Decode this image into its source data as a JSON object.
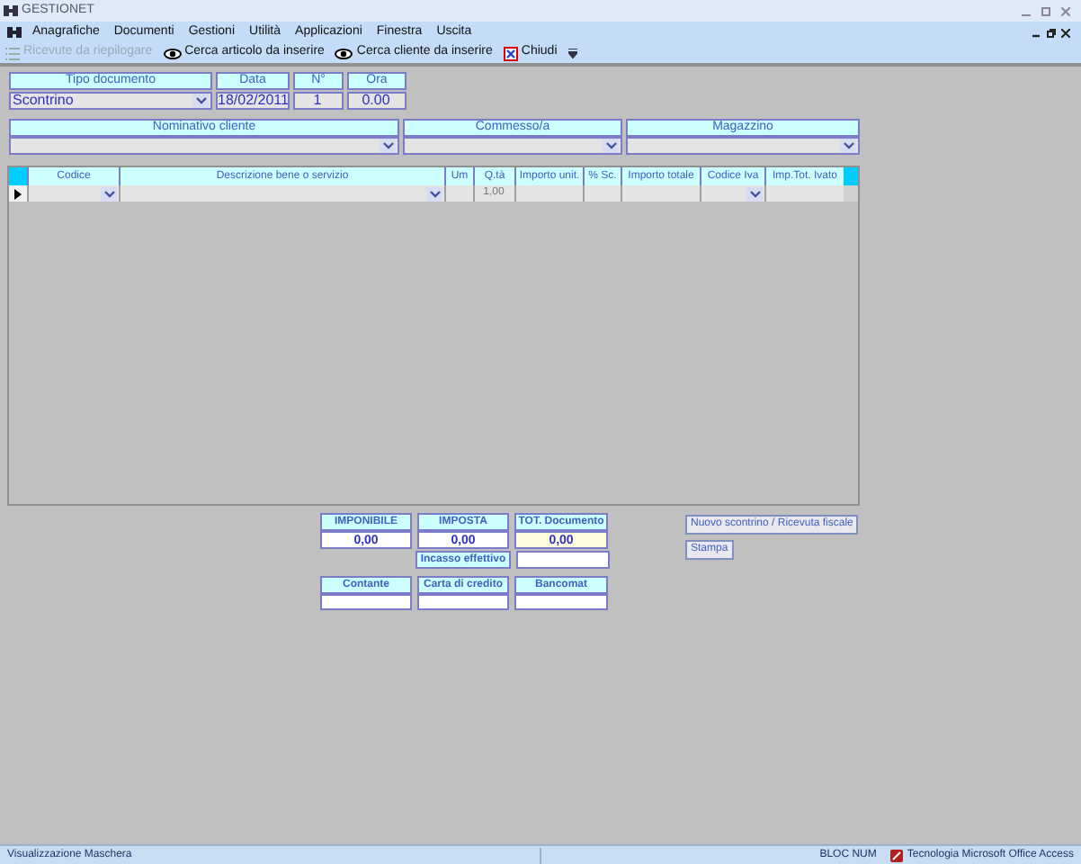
{
  "window": {
    "title": "GESTIONET"
  },
  "menu": [
    "Anagrafiche",
    "Documenti",
    "Gestioni",
    "Utilità",
    "Applicazioni",
    "Finestra",
    "Uscita"
  ],
  "toolbar": [
    {
      "label": "Ricevute da riepilogare",
      "kind": "list",
      "disabled": true
    },
    {
      "label": "Cerca articolo da inserire",
      "kind": "eye",
      "disabled": false
    },
    {
      "label": "Cerca cliente da inserire",
      "kind": "eye",
      "disabled": false
    },
    {
      "label": "Chiudi",
      "kind": "close",
      "disabled": false
    }
  ],
  "header_fields": [
    {
      "label": "Tipo documento",
      "value": "Scontrino",
      "kind": "dropdown"
    },
    {
      "label": "Data",
      "value": "18/02/2011",
      "kind": "text"
    },
    {
      "label": "N°",
      "value": "1",
      "kind": "text"
    },
    {
      "label": "Ora",
      "value": "0.00",
      "kind": "text"
    }
  ],
  "party_fields": [
    {
      "label": "Nominativo cliente",
      "kind": "dropdown"
    },
    {
      "label": "Commesso/a",
      "kind": "dropdown"
    },
    {
      "label": "Magazzino",
      "kind": "dropdown"
    }
  ],
  "grid": {
    "columns": [
      {
        "label": "Codice",
        "kind": "dropdown"
      },
      {
        "label": "Descrizione bene o servizio",
        "kind": "dropdown"
      },
      {
        "label": "Um",
        "kind": "text"
      },
      {
        "label": "Q.tà",
        "kind": "text",
        "value": "1,00"
      },
      {
        "label": "Importo unit.",
        "kind": "text"
      },
      {
        "label": "% Sc.",
        "kind": "text"
      },
      {
        "label": "Importo totale",
        "kind": "text"
      },
      {
        "label": "Codice Iva",
        "kind": "dropdown"
      },
      {
        "label": "Imp.Tot. Ivato",
        "kind": "text"
      }
    ]
  },
  "totals": [
    {
      "label": "IMPONIBILE",
      "value": "0,00",
      "highlighted": false
    },
    {
      "label": "IMPOSTA",
      "value": "0,00",
      "highlighted": false
    },
    {
      "label": "TOT. Documento",
      "value": "0,00",
      "highlighted": true
    }
  ],
  "cash_received": {
    "label": "Incasso effettivo"
  },
  "payments": [
    {
      "label": "Contante"
    },
    {
      "label": "Carta di credito"
    },
    {
      "label": "Bancomat"
    }
  ],
  "buttons": [
    "Nuovo scontrino / Ricevuta fiscale",
    "Stampa"
  ],
  "status_bar": {
    "text": "Visualizzazione Maschera",
    "indicator": "BLOC NUM",
    "app": "Tecnologia Microsoft Office Access"
  }
}
